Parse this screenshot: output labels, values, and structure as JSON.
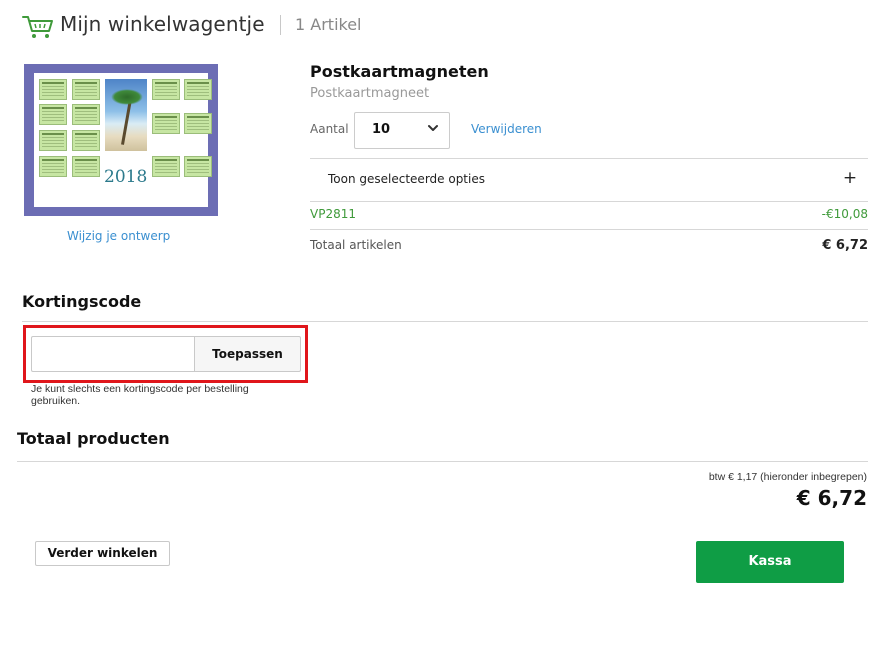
{
  "header": {
    "icon": "shopping-cart-icon",
    "title": "Mijn winkelwagentje",
    "item_count": "1 Artikel",
    "accent": "#3f9a3a"
  },
  "product": {
    "image_year": "2018",
    "edit_link": "Wijzig je ontwerp",
    "name": "Postkaartmagneten",
    "subtitle": "Postkaartmagneet",
    "quantity_label": "Aantal",
    "quantity_value": "10",
    "remove_link": "Verwijderen",
    "options_label": "Toon geselecteerde opties",
    "options_toggle": "+",
    "discount_code": "VP2811",
    "discount_amount": "-€10,08",
    "total_label": "Totaal artikelen",
    "total_value": "€ 6,72"
  },
  "coupon": {
    "title": "Kortingscode",
    "input_value": "",
    "apply_label": "Toepassen",
    "note": "Je kunt slechts een kortingscode per bestelling gebruiken.",
    "highlight_color": "#e0161b"
  },
  "totals": {
    "title": "Totaal producten",
    "vat_note": "btw € 1,17 (hieronder inbegrepen)",
    "grand_total": "€ 6,72"
  },
  "actions": {
    "continue_label": "Verder winkelen",
    "checkout_label": "Kassa",
    "checkout_color": "#0f9d45"
  }
}
